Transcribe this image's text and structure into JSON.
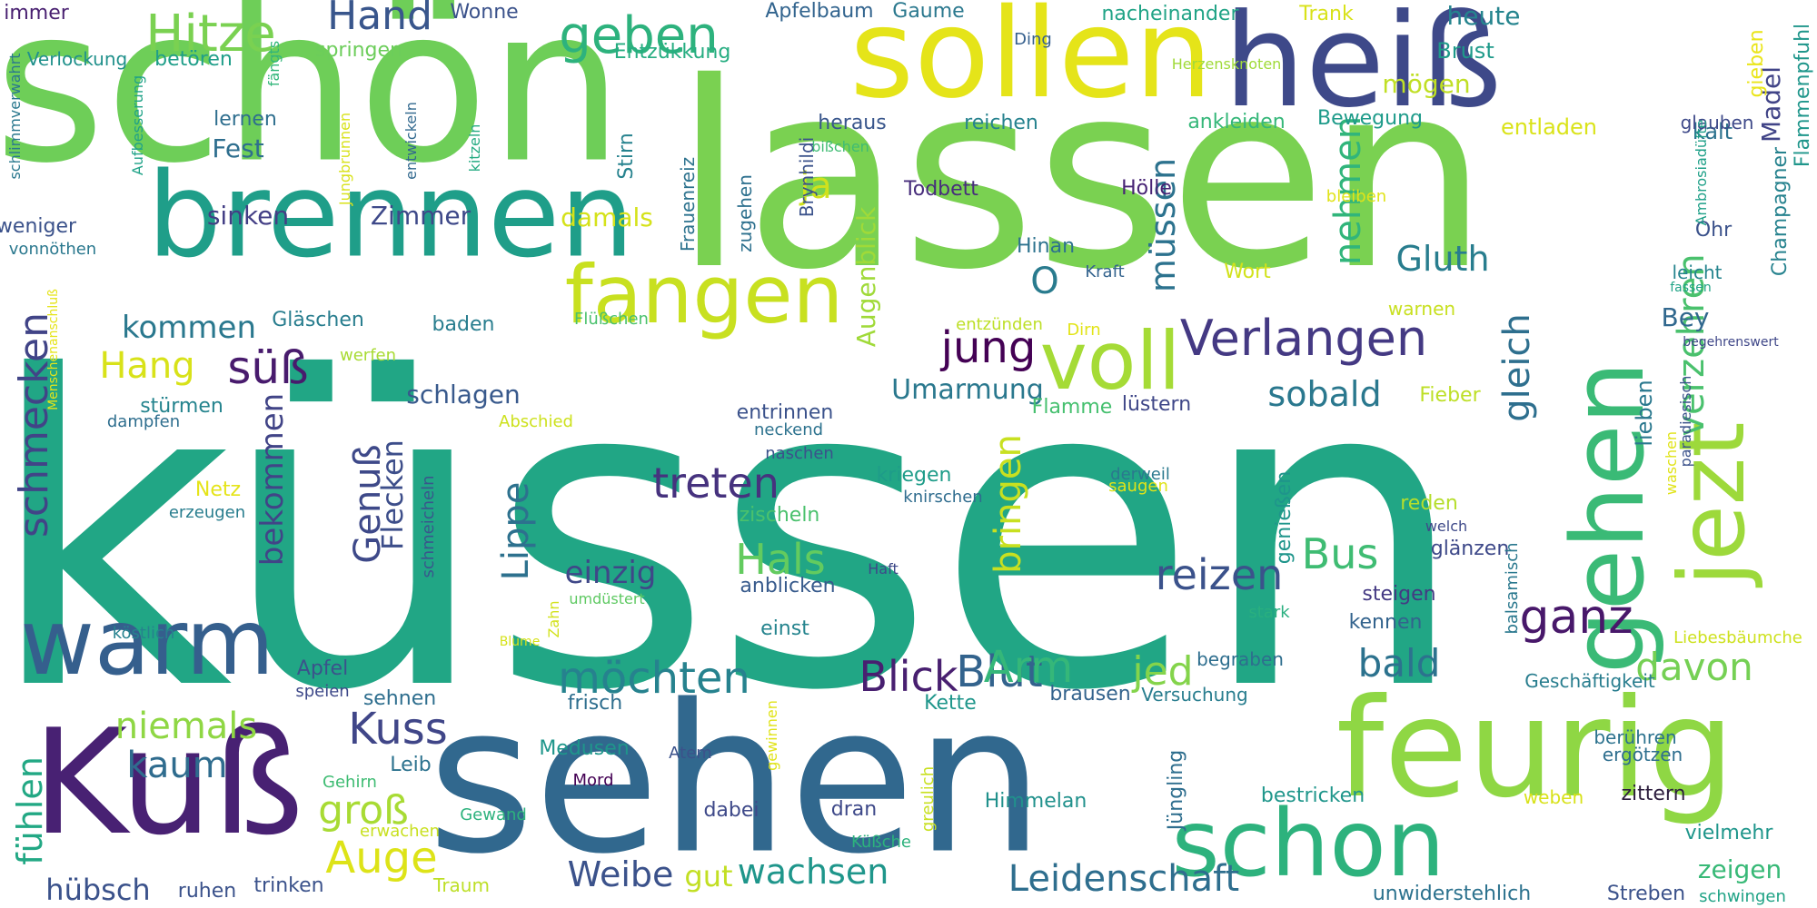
{
  "words": [
    {
      "t": "küssen",
      "c": "#21a685"
    },
    {
      "t": "lassen",
      "c": "#7ad151"
    },
    {
      "t": "schön",
      "c": "#6ece58"
    },
    {
      "t": "sollen",
      "c": "#e5e419"
    },
    {
      "t": "heiß",
      "c": "#3e4989"
    },
    {
      "t": "brennen",
      "c": "#1f9e89"
    },
    {
      "t": "sehen",
      "c": "#31688e"
    },
    {
      "t": "feurig",
      "c": "#8fd744"
    },
    {
      "t": "Kuß",
      "c": "#482173"
    },
    {
      "t": "warm",
      "c": "#355f8d"
    },
    {
      "t": "schon",
      "c": "#2db27d"
    },
    {
      "t": "gehen",
      "c": "#3aba76"
    },
    {
      "t": "jezt",
      "c": "#9dd93b"
    },
    {
      "t": "fangen",
      "c": "#c8e020"
    },
    {
      "t": "voll",
      "c": "#a5db36"
    },
    {
      "t": "Hitze",
      "c": "#7ad151"
    },
    {
      "t": "geben",
      "c": "#2db27d"
    },
    {
      "t": "Hand",
      "c": "#39568c"
    },
    {
      "t": "Verlangen",
      "c": "#443983"
    },
    {
      "t": "jung",
      "c": "#440154"
    },
    {
      "t": "süß",
      "c": "#481b6d"
    },
    {
      "t": "Hang",
      "c": "#d8e219"
    },
    {
      "t": "schmecken",
      "c": "#414487"
    },
    {
      "t": "kommen",
      "c": "#2a788e"
    },
    {
      "t": "müssen",
      "c": "#2c728e"
    },
    {
      "t": "Gluth",
      "c": "#287d8e"
    },
    {
      "t": "nehmen",
      "c": "#31b57b"
    },
    {
      "t": "gleich",
      "c": "#2e6f8e"
    },
    {
      "t": "verzehren",
      "c": "#4ac16d"
    },
    {
      "t": "sobald",
      "c": "#2a788e"
    },
    {
      "t": "treten",
      "c": "#46327e"
    },
    {
      "t": "reizen",
      "c": "#3b528b"
    },
    {
      "t": "ganz",
      "c": "#48186a"
    },
    {
      "t": "Bus",
      "c": "#3fbc73"
    },
    {
      "t": "Blut",
      "c": "#33638d"
    },
    {
      "t": "möchten",
      "c": "#26828e"
    },
    {
      "t": "Blick",
      "c": "#481f70"
    },
    {
      "t": "Arm",
      "c": "#35b779"
    },
    {
      "t": "jed",
      "c": "#84d44b"
    },
    {
      "t": "bald",
      "c": "#2c728e"
    },
    {
      "t": "davon",
      "c": "#75d054"
    },
    {
      "t": "Kuss",
      "c": "#404688"
    },
    {
      "t": "kaum",
      "c": "#2f6c8e"
    },
    {
      "t": "niemals",
      "c": "#8fd744"
    },
    {
      "t": "groß",
      "c": "#a8db34"
    },
    {
      "t": "Auge",
      "c": "#dde318"
    },
    {
      "t": "fühlen",
      "c": "#22a884"
    },
    {
      "t": "hübsch",
      "c": "#3b528b"
    },
    {
      "t": "Weibe",
      "c": "#3b528b"
    },
    {
      "t": "gut",
      "c": "#c2df23"
    },
    {
      "t": "wachsen",
      "c": "#1f968b"
    },
    {
      "t": "Leidenschaft",
      "c": "#2e6e8e"
    },
    {
      "t": "zeigen",
      "c": "#38b977"
    },
    {
      "t": "Lippe",
      "c": "#2d718e"
    },
    {
      "t": "Genuß",
      "c": "#3e4989"
    },
    {
      "t": "Flecken",
      "c": "#3d4e8a"
    },
    {
      "t": "bekommen",
      "c": "#414487"
    },
    {
      "t": "Hals",
      "c": "#63cb5f"
    },
    {
      "t": "bringen",
      "c": "#c8e020"
    },
    {
      "t": "einzig",
      "c": "#3f4788"
    },
    {
      "t": "Umarmung",
      "c": "#2a788e"
    },
    {
      "t": "O",
      "c": "#297b8e"
    },
    {
      "t": "ja",
      "c": "#d0e11c"
    },
    {
      "t": "damals",
      "c": "#d5e21a"
    },
    {
      "t": "sinken",
      "c": "#433e85"
    },
    {
      "t": "Zimmer",
      "c": "#3e4989"
    },
    {
      "t": "Fest",
      "c": "#2e6e8e"
    },
    {
      "t": "Augenblick",
      "c": "#a0da39"
    },
    {
      "t": "schlagen",
      "c": "#38598c"
    },
    {
      "t": "entrinnen",
      "c": "#3b528b"
    },
    {
      "t": "Todbett",
      "c": "#472d7b"
    },
    {
      "t": "Hölle",
      "c": "#482475"
    },
    {
      "t": "Hinan",
      "c": "#2c728e"
    },
    {
      "t": "Kraft",
      "c": "#33638d"
    },
    {
      "t": "Wort",
      "c": "#d2e21b"
    },
    {
      "t": "Bey",
      "c": "#31688e"
    },
    {
      "t": "Madel",
      "c": "#414487"
    },
    {
      "t": "Ohr",
      "c": "#3b528b"
    },
    {
      "t": "leicht",
      "c": "#25848e"
    },
    {
      "t": "fassen",
      "c": "#20a386"
    },
    {
      "t": "warnen",
      "c": "#c8e020"
    },
    {
      "t": "Fieber",
      "c": "#bddf26"
    },
    {
      "t": "lieben",
      "c": "#2a788e"
    },
    {
      "t": "genießen",
      "c": "#1f958b"
    },
    {
      "t": "reden",
      "c": "#b5de2b"
    },
    {
      "t": "welch",
      "c": "#3e4989"
    },
    {
      "t": "glänzen",
      "c": "#3e4989"
    },
    {
      "t": "steigen",
      "c": "#443983"
    },
    {
      "t": "kennen",
      "c": "#33638d"
    },
    {
      "t": "stark",
      "c": "#29af7f"
    },
    {
      "t": "Kette",
      "c": "#1f968b"
    },
    {
      "t": "brausen",
      "c": "#33638d"
    },
    {
      "t": "kriegen",
      "c": "#1e9c89"
    },
    {
      "t": "knirschen",
      "c": "#2f6c8e"
    },
    {
      "t": "zischeln",
      "c": "#4ac16d"
    },
    {
      "t": "Haft",
      "c": "#3e4989"
    },
    {
      "t": "anblicken",
      "c": "#375a8c"
    },
    {
      "t": "umdüstert",
      "c": "#5ec962"
    },
    {
      "t": "einst",
      "c": "#25848e"
    },
    {
      "t": "Flamme",
      "c": "#46c06f"
    },
    {
      "t": "lüstern",
      "c": "#3f4788"
    },
    {
      "t": "heute",
      "c": "#25848e"
    },
    {
      "t": "Brust",
      "c": "#1f9a8a"
    },
    {
      "t": "mögen",
      "c": "#c0df25"
    },
    {
      "t": "kalt",
      "c": "#2c728e"
    },
    {
      "t": "entladen",
      "c": "#dae319"
    },
    {
      "t": "glauben",
      "c": "#3e4989"
    },
    {
      "t": "gieben",
      "c": "#eae51a"
    },
    {
      "t": "Champagner",
      "c": "#26828e"
    },
    {
      "t": "Flammenpfuhl",
      "c": "#1f968b"
    },
    {
      "t": "Ambrosiadüfte",
      "c": "#1fa088"
    },
    {
      "t": "begehrenswert",
      "c": "#3f4788"
    },
    {
      "t": "Bewegung",
      "c": "#1e9b8a"
    },
    {
      "t": "ankleiden",
      "c": "#35b779"
    },
    {
      "t": "reichen",
      "c": "#26828e"
    },
    {
      "t": "heraus",
      "c": "#39568c"
    },
    {
      "t": "bißchen",
      "c": "#3fbc73"
    },
    {
      "t": "Apfelbaum",
      "c": "#32648e"
    },
    {
      "t": "Gaume",
      "c": "#2a788e"
    },
    {
      "t": "Ding",
      "c": "#355f8d"
    },
    {
      "t": "nacheinander",
      "c": "#20a386"
    },
    {
      "t": "Trank",
      "c": "#d8e219"
    },
    {
      "t": "Wonne",
      "c": "#3b528b"
    },
    {
      "t": "springen",
      "c": "#6ccd5a"
    },
    {
      "t": "Entzükkung",
      "c": "#26ad81"
    },
    {
      "t": "Herzensknoten",
      "c": "#a0da39"
    },
    {
      "t": "immer",
      "c": "#481f70"
    },
    {
      "t": "Verlockung",
      "c": "#21918c"
    },
    {
      "t": "betören",
      "c": "#1f9e89"
    },
    {
      "t": "fängts",
      "c": "#32b67a"
    },
    {
      "t": "lernen",
      "c": "#2e6e8e"
    },
    {
      "t": "schlimmverwahrt",
      "c": "#2a788e"
    },
    {
      "t": "Aufbesserung",
      "c": "#1fa287"
    },
    {
      "t": "Jungbrunnen",
      "c": "#d8e219"
    },
    {
      "t": "entwickeln",
      "c": "#31688e"
    },
    {
      "t": "kitzeln",
      "c": "#25ab82"
    },
    {
      "t": "Stirn",
      "c": "#26828e"
    },
    {
      "t": "Frauenreiz",
      "c": "#2c728e"
    },
    {
      "t": "zugehen",
      "c": "#2d708e"
    },
    {
      "t": "Brynhildi",
      "c": "#3b528b"
    },
    {
      "t": "weniger",
      "c": "#3b528b"
    },
    {
      "t": "vonnöthen",
      "c": "#2a788e"
    },
    {
      "t": "Menschenanschluß",
      "c": "#e5e419"
    },
    {
      "t": "werfen",
      "c": "#a8db34"
    },
    {
      "t": "Gläschen",
      "c": "#287d8e"
    },
    {
      "t": "baden",
      "c": "#287d8e"
    },
    {
      "t": "Flüßchen",
      "c": "#4ac16d"
    },
    {
      "t": "stürmen",
      "c": "#25848e"
    },
    {
      "t": "dampfen",
      "c": "#2e6e8e"
    },
    {
      "t": "Abschied",
      "c": "#cde11d"
    },
    {
      "t": "schmeicheln",
      "c": "#39568c"
    },
    {
      "t": "neckend",
      "c": "#2c728e"
    },
    {
      "t": "naschen",
      "c": "#3b528b"
    },
    {
      "t": "entzünden",
      "c": "#bddf26"
    },
    {
      "t": "Dirn",
      "c": "#e2e418"
    },
    {
      "t": "derweil",
      "c": "#2a788e"
    },
    {
      "t": "saugen",
      "c": "#e0e318"
    },
    {
      "t": "Netz",
      "c": "#e5e419"
    },
    {
      "t": "erzeugen",
      "c": "#287d8e"
    },
    {
      "t": "köstlich",
      "c": "#26828e"
    },
    {
      "t": "Blume",
      "c": "#d5e21a"
    },
    {
      "t": "Zahn",
      "c": "#d2e21b"
    },
    {
      "t": "Apfel",
      "c": "#3b528b"
    },
    {
      "t": "speien",
      "c": "#3e4989"
    },
    {
      "t": "sehnen",
      "c": "#2e6e8e"
    },
    {
      "t": "frisch",
      "c": "#2e6e8e"
    },
    {
      "t": "Medusen",
      "c": "#1f968b"
    },
    {
      "t": "Atem",
      "c": "#3b528b"
    },
    {
      "t": "Mord",
      "c": "#440154"
    },
    {
      "t": "gewinnen",
      "c": "#e0e318"
    },
    {
      "t": "Leib",
      "c": "#2c728e"
    },
    {
      "t": "Gehirn",
      "c": "#3fbc73"
    },
    {
      "t": "erwachen",
      "c": "#c8e020"
    },
    {
      "t": "Gewand",
      "c": "#2db27d"
    },
    {
      "t": "dabei",
      "c": "#3e4989"
    },
    {
      "t": "dran",
      "c": "#3e4989"
    },
    {
      "t": "greulich",
      "c": "#c8e020"
    },
    {
      "t": "Küßche",
      "c": "#2db27d"
    },
    {
      "t": "Himmelan",
      "c": "#21918c"
    },
    {
      "t": "Jüngling",
      "c": "#2e6e8e"
    },
    {
      "t": "begraben",
      "c": "#2e6e8e"
    },
    {
      "t": "Versuchung",
      "c": "#287d8e"
    },
    {
      "t": "bestricken",
      "c": "#1f968b"
    },
    {
      "t": "weben",
      "c": "#d8e219"
    },
    {
      "t": "zittern",
      "c": "#2d1e3e"
    },
    {
      "t": "berühren",
      "c": "#2c728e"
    },
    {
      "t": "ergötzen",
      "c": "#2e6e8e"
    },
    {
      "t": "vielmehr",
      "c": "#1f968b"
    },
    {
      "t": "Geschäftigkeit",
      "c": "#287d8e"
    },
    {
      "t": "Liebesbäumche",
      "c": "#cde11d"
    },
    {
      "t": "balsamisch",
      "c": "#2a788e"
    },
    {
      "t": "Balsamisch",
      "c": "#2a788e"
    },
    {
      "t": "waschen",
      "c": "#e0e318"
    },
    {
      "t": "paradiesisch",
      "c": "#3b528b"
    },
    {
      "t": "bleiben",
      "c": "#e0e318"
    },
    {
      "t": "ruhen",
      "c": "#3b528b"
    },
    {
      "t": "trinken",
      "c": "#3b528b"
    },
    {
      "t": "Traum",
      "c": "#bddf26"
    },
    {
      "t": "unwiderstehlich",
      "c": "#2c728e"
    },
    {
      "t": "Streben",
      "c": "#3b528b"
    },
    {
      "t": "schwingen",
      "c": "#20a386"
    }
  ]
}
